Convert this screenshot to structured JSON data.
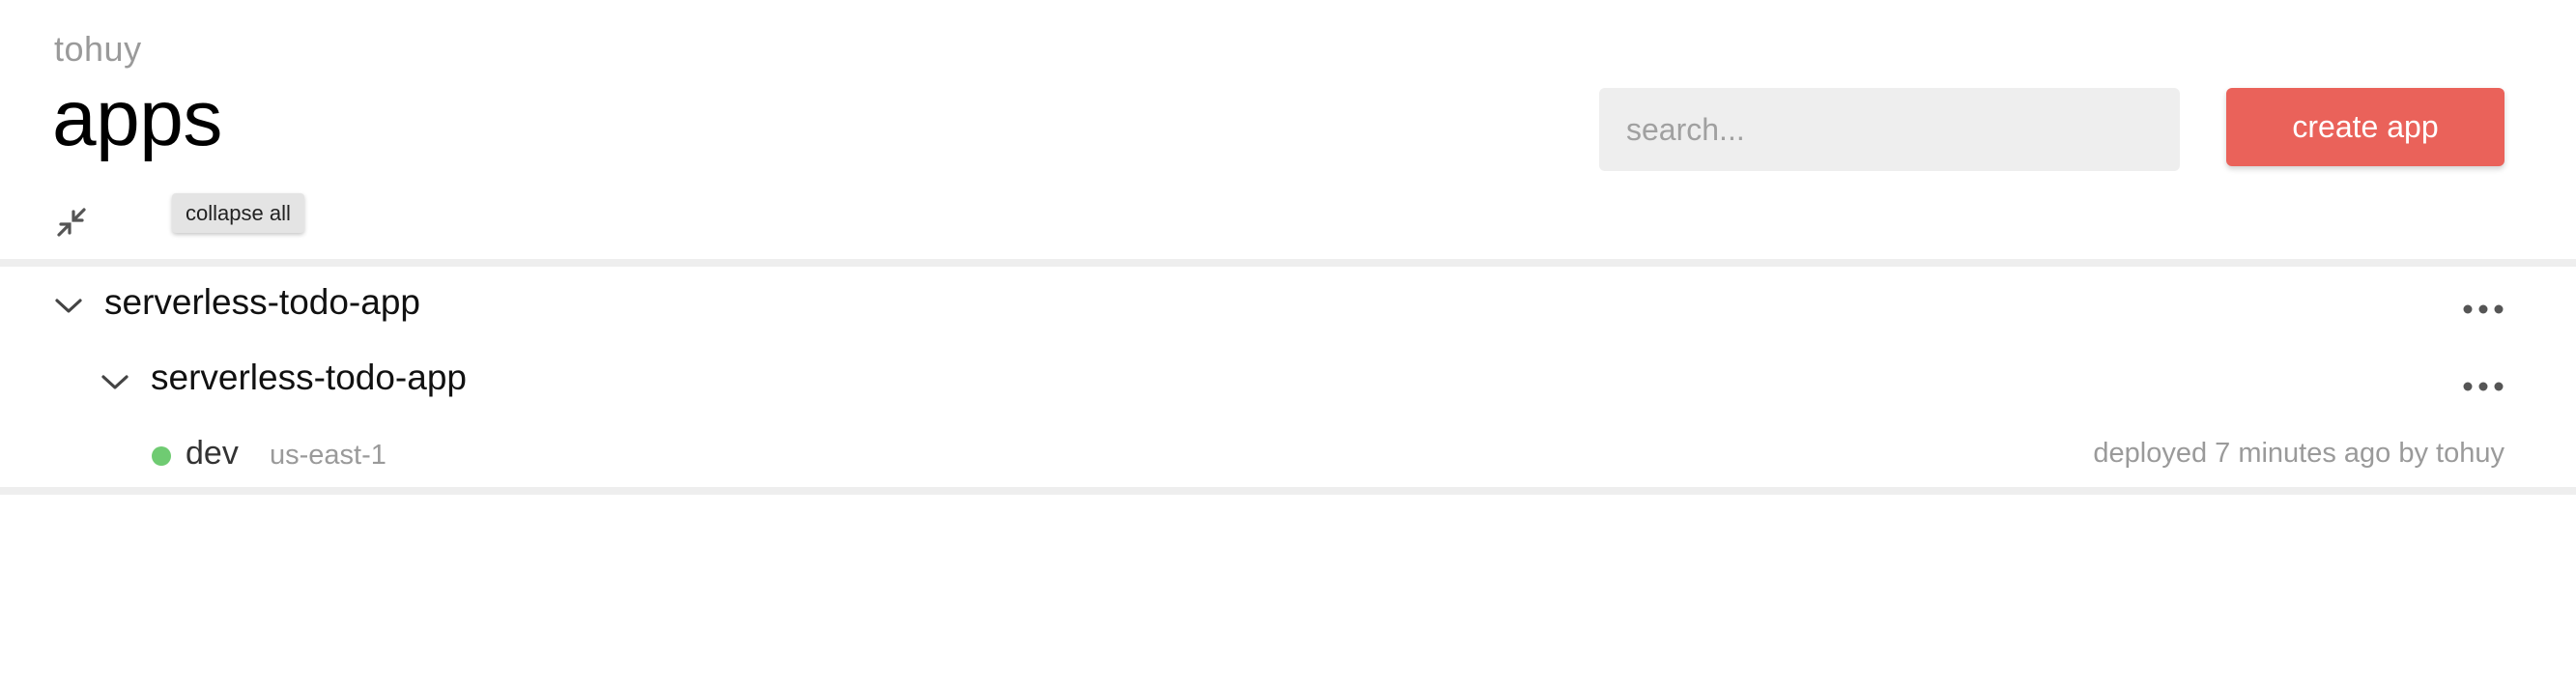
{
  "header": {
    "org_name": "tohuy",
    "page_title": "apps"
  },
  "search": {
    "placeholder": "search...",
    "value": ""
  },
  "actions": {
    "create_label": "create app",
    "accent_color": "#ea625a"
  },
  "toolbar": {
    "collapse_icon": "collapse-arrows-icon",
    "collapse_tooltip": "collapse all"
  },
  "apps": [
    {
      "name": "serverless-todo-app",
      "expanded": true,
      "services": [
        {
          "name": "serverless-todo-app",
          "expanded": true,
          "stages": [
            {
              "name": "dev",
              "region": "us-east-1",
              "status_color": "#6fcb72",
              "deploy_info": "deployed 7 minutes ago by tohuy"
            }
          ]
        }
      ]
    }
  ]
}
